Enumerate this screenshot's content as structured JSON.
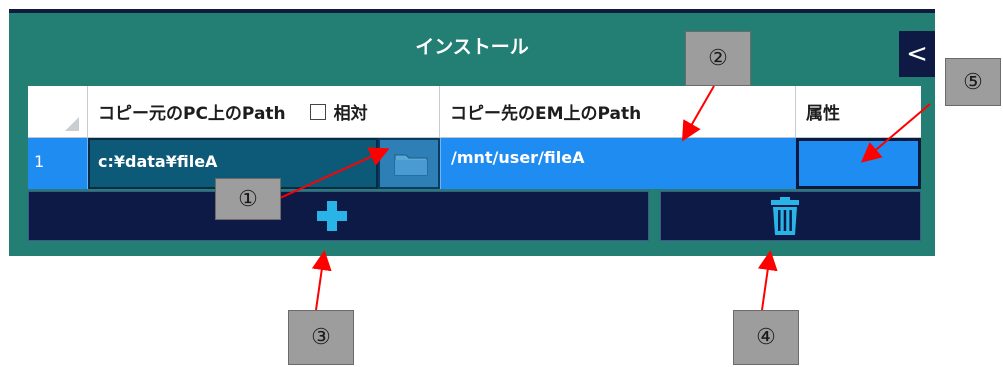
{
  "panel": {
    "title": "インストール",
    "collapse_glyph": "<"
  },
  "grid": {
    "headers": {
      "source_path": "コピー元のPC上のPath",
      "relative": "相対",
      "dest_path": "コピー先のEM上のPath",
      "attribute": "属性"
    },
    "rows": [
      {
        "num": "1",
        "source_path": "c:¥data¥fileA",
        "dest_path": "/mnt/user/fileA",
        "attribute": ""
      }
    ]
  },
  "icons": {
    "browse": "folder-icon",
    "add": "plus-icon",
    "delete": "trash-icon",
    "collapse": "chevron-left-icon"
  },
  "annotations": [
    "①",
    "②",
    "③",
    "④",
    "⑤"
  ],
  "colors": {
    "panel_bg": "#237e74",
    "row_selected": "#1f8cf2",
    "button_bg": "#0c1a45",
    "accent_icon": "#29b3e6",
    "callout_bg": "#9d9d9d",
    "arrow": "#ff0000"
  }
}
